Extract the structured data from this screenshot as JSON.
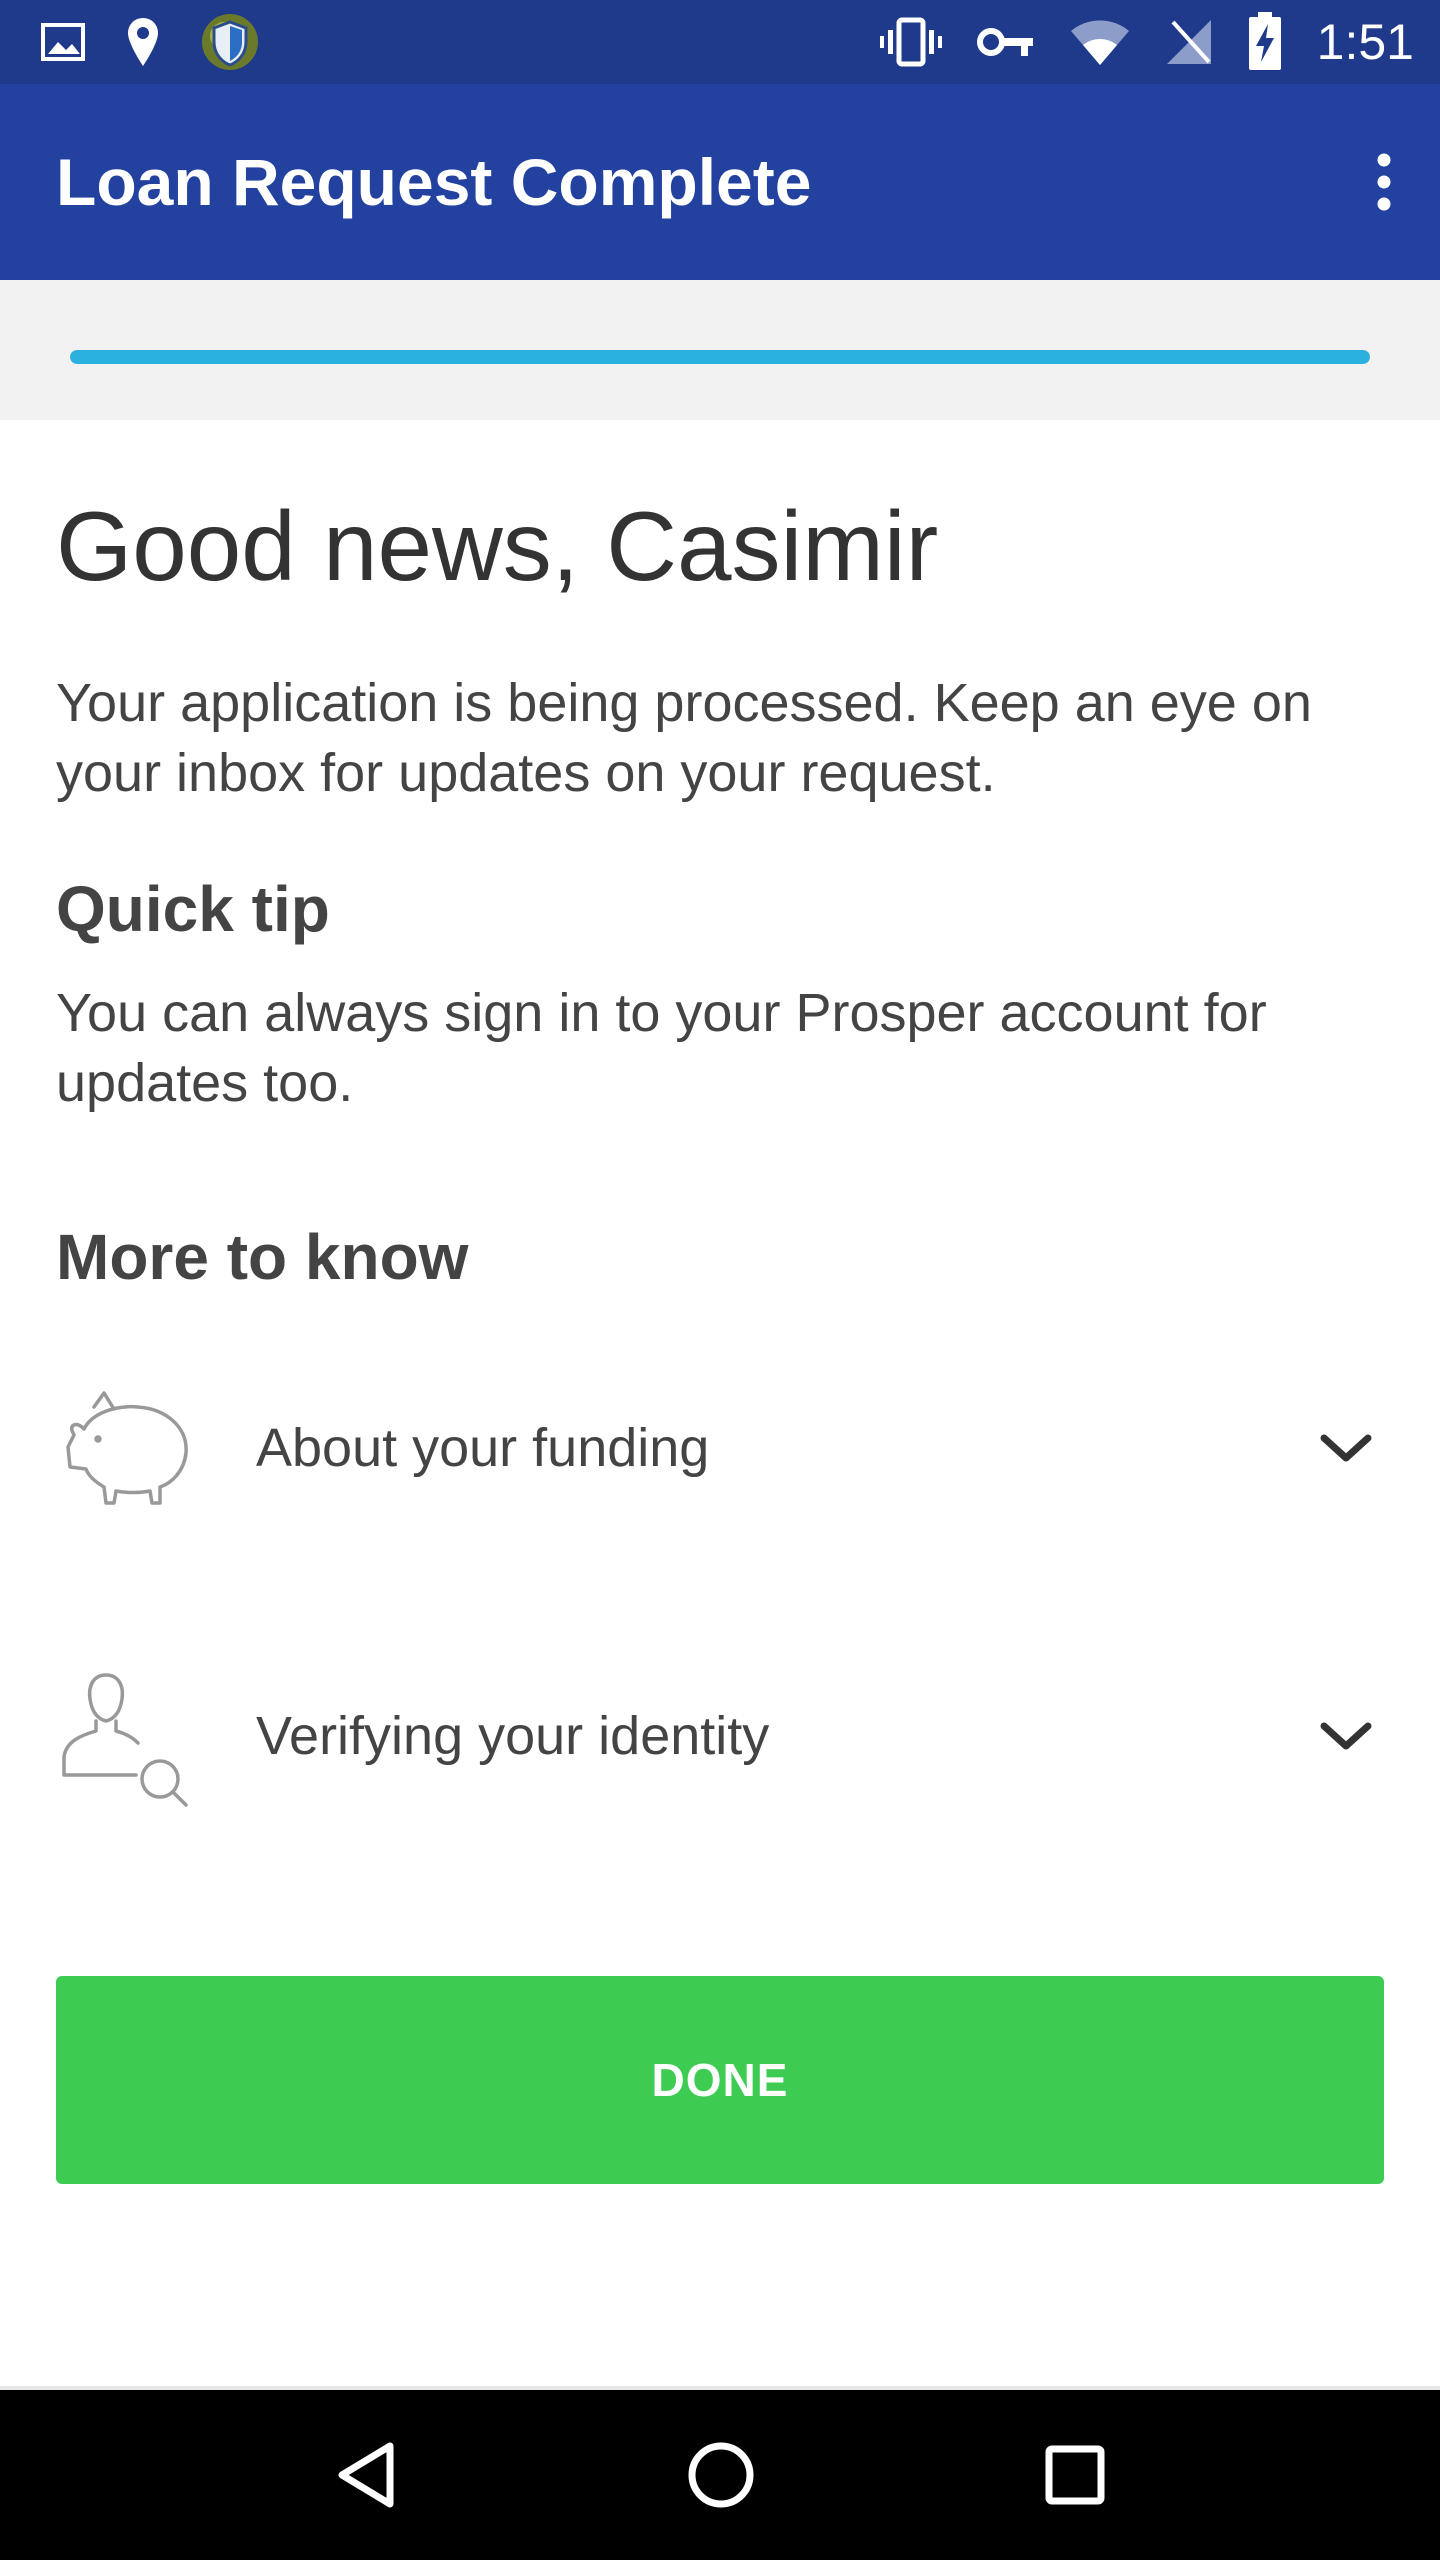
{
  "status_bar": {
    "time": "1:51",
    "left_icons": [
      "image-icon",
      "location-pin-icon",
      "security-shield-icon"
    ],
    "right_icons": [
      "vibrate-icon",
      "vpn-key-icon",
      "wifi-icon",
      "no-signal-icon",
      "battery-charging-icon"
    ]
  },
  "app_bar": {
    "title": "Loan Request Complete",
    "menu_icon": "more-vert-icon"
  },
  "progress": {
    "value_percent": 100,
    "color": "#2bb1e0"
  },
  "main": {
    "greeting": "Good news, Casimir",
    "intro": "Your application is being processed. Keep an eye on your inbox for updates on your request.",
    "tip_heading": "Quick tip",
    "tip_text": "You can always sign in to your Prosper account for updates too.",
    "more_heading": "More to know",
    "accordion": [
      {
        "label": "About your funding",
        "icon": "piggy-bank-icon"
      },
      {
        "label": "Verifying your identity",
        "icon": "person-search-icon"
      }
    ],
    "done_label": "DONE"
  },
  "colors": {
    "status_bar": "#1f3a8a",
    "app_bar": "#2342a0",
    "done_button": "#3ecb52",
    "progress": "#2bb1e0"
  },
  "nav_bar": {
    "icons": [
      "back-icon",
      "home-icon",
      "recents-icon"
    ]
  }
}
